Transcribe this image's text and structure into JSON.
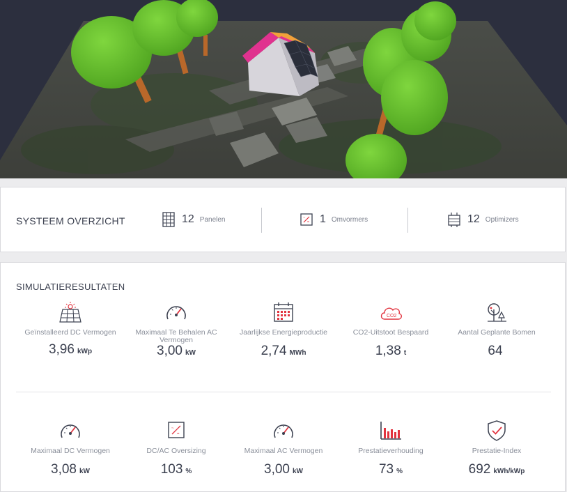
{
  "overview": {
    "title": "SYSTEEM OVERZICHT",
    "items": [
      {
        "icon": "solar-panel-grid-icon",
        "count": "12",
        "label": "Panelen"
      },
      {
        "icon": "inverter-icon",
        "count": "1",
        "label": "Omvormers"
      },
      {
        "icon": "optimizer-icon",
        "count": "12",
        "label": "Optimizers"
      }
    ]
  },
  "results": {
    "title": "SIMULATIERESULTATEN",
    "row1": [
      {
        "icon": "solar-panel-sun-icon",
        "label": "Geïnstalleerd DC Vermogen",
        "value": "3,96",
        "unit": "kWp"
      },
      {
        "icon": "gauge-icon",
        "label": "Maximaal Te Behalen AC Vermogen",
        "value": "3,00",
        "unit": "kW"
      },
      {
        "icon": "calendar-icon",
        "label": "Jaarlijkse Energieproductie",
        "value": "2,74",
        "unit": "MWh"
      },
      {
        "icon": "co2-cloud-icon",
        "label": "CO2-Uitstoot Bespaard",
        "value": "1,38",
        "unit": "t"
      },
      {
        "icon": "trees-icon",
        "label": "Aantal Geplante Bomen",
        "value": "64",
        "unit": ""
      }
    ],
    "row2": [
      {
        "icon": "gauge-icon",
        "label": "Maximaal DC Vermogen",
        "value": "3,08",
        "unit": "kW"
      },
      {
        "icon": "oversizing-icon",
        "label": "DC/AC Oversizing",
        "value": "103",
        "unit": "%"
      },
      {
        "icon": "gauge-icon",
        "label": "Maximaal AC Vermogen",
        "value": "3,00",
        "unit": "kW"
      },
      {
        "icon": "bar-chart-icon",
        "label": "Prestatieverhouding",
        "value": "73",
        "unit": "%"
      },
      {
        "icon": "shield-check-icon",
        "label": "Prestatie-Index",
        "value": "692",
        "unit": "kWh/kWp"
      }
    ],
    "co2_icon_text": "CO2"
  },
  "colors": {
    "accent_red": "#e2333f",
    "scene_bg": "#2c2f3e",
    "tree_green": "#6cc233",
    "trunk_brown": "#b9682a",
    "roof_magenta": "#e0328f"
  }
}
